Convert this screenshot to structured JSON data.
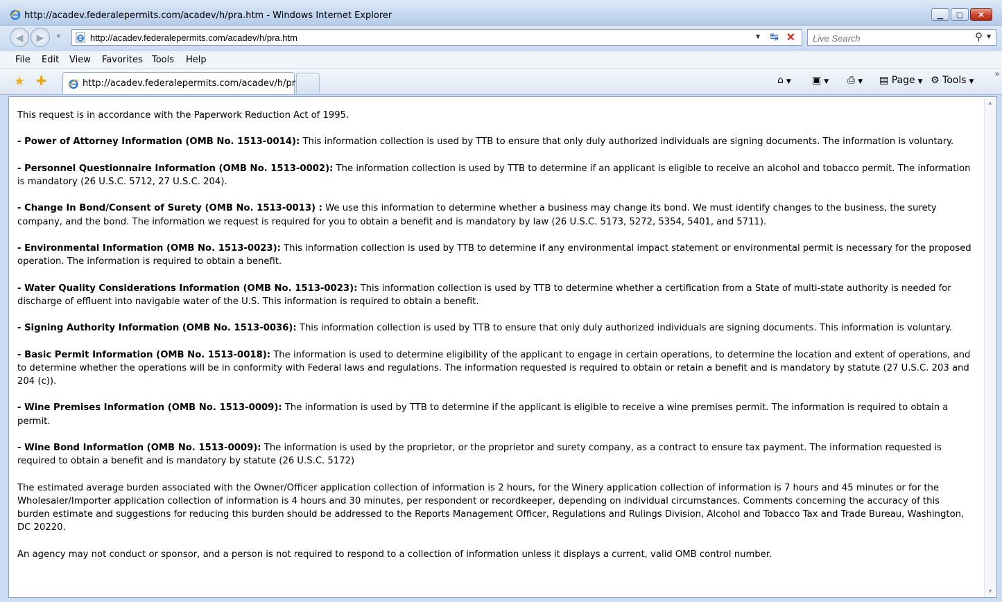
{
  "window": {
    "title": "http://acadev.federalepermits.com/acadev/h/pra.htm - Windows Internet Explorer"
  },
  "address_bar": {
    "url": "http://acadev.federalepermits.com/acadev/h/pra.htm",
    "search_placeholder": "Live Search"
  },
  "menu": [
    "File",
    "Edit",
    "View",
    "Favorites",
    "Tools",
    "Help"
  ],
  "tab": {
    "label": "http://acadev.federalepermits.com/acadev/h/pra..."
  },
  "commands": {
    "page": "Page",
    "tools": "Tools"
  },
  "content": {
    "intro": "This request is in accordance with the Paperwork Reduction Act of 1995.",
    "items": [
      {
        "head": "- Power of Attorney Information (OMB No. 1513-0014):",
        "body": " This information collection is used by TTB to ensure that only duly authorized individuals are signing documents. The information is voluntary."
      },
      {
        "head": "- Personnel Questionnaire Information (OMB No. 1513-0002):",
        "body": " The information collection is used by TTB to determine if an applicant is eligible to receive an alcohol and tobacco permit. The information is mandatory (26 U.S.C. 5712, 27 U.S.C. 204)."
      },
      {
        "head": "- Change In Bond/Consent of Surety (OMB No. 1513-0013) :",
        "body": " We use this information to determine whether a business may change its bond. We must identify changes to the business, the surety company, and the bond. The information we request is required for you to obtain a benefit and is mandatory by law (26 U.S.C. 5173, 5272, 5354, 5401, and 5711)."
      },
      {
        "head": "- Environmental Information (OMB No. 1513-0023):",
        "body": " This information collection is used by TTB to determine if any environmental impact statement or environmental permit is necessary for the proposed operation. The information is required to obtain a benefit."
      },
      {
        "head": "- Water Quality Considerations Information (OMB No. 1513-0023):",
        "body": " This information collection is used by TTB to determine whether a certification from a State of multi-state authority is needed for discharge of effluent into navigable water of the U.S. This information is required to obtain a benefit."
      },
      {
        "head": "- Signing Authority Information (OMB No. 1513-0036):",
        "body": " This information collection is used by TTB to ensure that only duly authorized individuals are signing documents. This information is voluntary."
      },
      {
        "head": "- Basic Permit Information (OMB No. 1513-0018):",
        "body": " The information is used to determine eligibility of the applicant to engage in certain operations, to determine the location and extent of operations, and to determine whether the operations will be in conformity with Federal laws and regulations. The information requested is required to obtain or retain a benefit and is mandatory by statute (27 U.S.C. 203 and 204 (c))."
      },
      {
        "head": "- Wine Premises Information (OMB No. 1513-0009):",
        "body": " The information is used by TTB to determine if the applicant is eligible to receive a wine premises permit. The information is required to obtain a permit."
      },
      {
        "head": "- Wine Bond Information (OMB No. 1513-0009):",
        "body": " The information is used by the proprietor, or the proprietor and surety company, as a contract to ensure tax payment. The information requested is required to obtain a benefit and is mandatory by statute (26 U.S.C. 5172)"
      }
    ],
    "burden": "The estimated average burden associated with the Owner/Officer application collection of information is 2 hours, for the Winery application collection of information is 7 hours and 45 minutes or for the Wholesaler/Importer application collection of information is 4 hours and 30 minutes, per respondent or recordkeeper, depending on individual circumstances. Comments concerning the accuracy of this burden estimate and suggestions for reducing this burden should be addressed to the Reports Management Officer, Regulations and Rulings Division, Alcohol and Tobacco Tax and Trade Bureau, Washington, DC 20220.",
    "closing": "An agency may not conduct or sponsor, and a person is not required to respond to a collection of information unless it displays a current, valid OMB control number."
  }
}
